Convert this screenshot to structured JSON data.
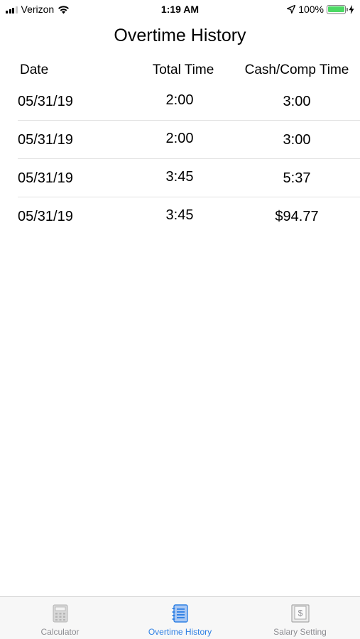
{
  "status_bar": {
    "carrier": "Verizon",
    "time": "1:19 AM",
    "battery": "100%",
    "battery_level": 1.0
  },
  "title": "Overtime History",
  "table": {
    "headers": [
      "Date",
      "Total Time",
      "Cash/Comp Time"
    ],
    "rows": [
      {
        "date": "05/31/19",
        "total": "2:00",
        "cash": "3:00"
      },
      {
        "date": "05/31/19",
        "total": "2:00",
        "cash": "3:00"
      },
      {
        "date": "05/31/19",
        "total": "3:45",
        "cash": "5:37"
      },
      {
        "date": "05/31/19",
        "total": "3:45",
        "cash": "$94.77"
      }
    ]
  },
  "tabs": [
    {
      "label": "Calculator",
      "icon": "calculator-icon",
      "active": false
    },
    {
      "label": "Overtime History",
      "icon": "notebook-icon",
      "active": true
    },
    {
      "label": "Salary Setting",
      "icon": "dollar-document-icon",
      "active": false
    }
  ],
  "colors": {
    "accent": "#2f80e4",
    "inactive_tab": "#8e8e93",
    "battery": "#4cd964"
  }
}
